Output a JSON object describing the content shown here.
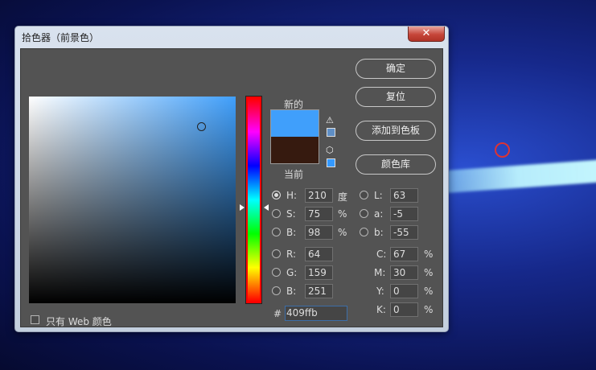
{
  "dialog": {
    "title": "拾色器（前景色）",
    "close_symbol": "✕"
  },
  "swatches": {
    "new_label": "新的",
    "current_label": "当前",
    "new_color": "#409ffb",
    "current_color": "#361a0f"
  },
  "buttons": {
    "ok": "确定",
    "reset": "复位",
    "add_to_swatches": "添加到色板",
    "color_libraries": "颜色库"
  },
  "hsb": {
    "h": {
      "label": "H:",
      "value": "210",
      "unit": "度"
    },
    "s": {
      "label": "S:",
      "value": "75",
      "unit": "%"
    },
    "b": {
      "label": "B:",
      "value": "98",
      "unit": "%"
    }
  },
  "rgb": {
    "r": {
      "label": "R:",
      "value": "64"
    },
    "g": {
      "label": "G:",
      "value": "159"
    },
    "b": {
      "label": "B:",
      "value": "251"
    }
  },
  "lab": {
    "l": {
      "label": "L:",
      "value": "63"
    },
    "a": {
      "label": "a:",
      "value": "-5"
    },
    "b": {
      "label": "b:",
      "value": "-55"
    }
  },
  "cmyk": {
    "c": {
      "label": "C:",
      "value": "67",
      "unit": "%"
    },
    "m": {
      "label": "M:",
      "value": "30",
      "unit": "%"
    },
    "y": {
      "label": "Y:",
      "value": "0",
      "unit": "%"
    },
    "k": {
      "label": "K:",
      "value": "0",
      "unit": "%"
    }
  },
  "hex": {
    "label": "#",
    "value": "409ffb"
  },
  "web_only": {
    "label": "只有 Web 颜色",
    "checked": false
  },
  "icons": {
    "gamut_warning": "⚠",
    "web_safe": "⬡"
  }
}
